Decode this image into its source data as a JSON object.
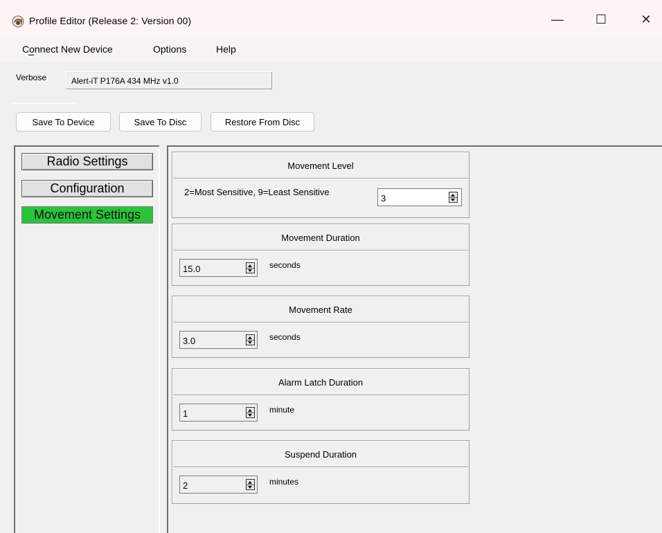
{
  "window": {
    "title": "Profile Editor (Release 2: Version 00)",
    "minimize": "—",
    "maximize": "☐",
    "close": "✕"
  },
  "menu": {
    "items": [
      {
        "label": "Connect New Device",
        "mnemonic": "o"
      },
      {
        "label": "Options"
      },
      {
        "label": "Help"
      }
    ]
  },
  "header": {
    "verbose_label": "Verbose",
    "device_name": "Alert-iT P176A 434 MHz v1.0"
  },
  "toolbar": {
    "save_to_device": "Save To Device",
    "save_to_disc": "Save To Disc",
    "restore_from_disc": "Restore From Disc"
  },
  "nav": {
    "items": [
      {
        "label": "Radio Settings",
        "active": false
      },
      {
        "label": "Configuration",
        "active": false
      },
      {
        "label": "Movement Settings",
        "active": true
      }
    ],
    "active_color": "#2bc33b"
  },
  "groups": {
    "movement_level": {
      "title": "Movement Level",
      "description": "2=Most Sensitive, 9=Least Sensitive",
      "value": "3"
    },
    "movement_duration": {
      "title": "Movement Duration",
      "value": "15.0",
      "unit": "seconds"
    },
    "movement_rate": {
      "title": "Movement Rate",
      "value": "3.0",
      "unit": "seconds"
    },
    "alarm_latch_duration": {
      "title": "Alarm Latch Duration",
      "value": "1",
      "unit": "minute"
    },
    "suspend_duration": {
      "title": "Suspend Duration",
      "value": "2",
      "unit": "minutes"
    }
  }
}
